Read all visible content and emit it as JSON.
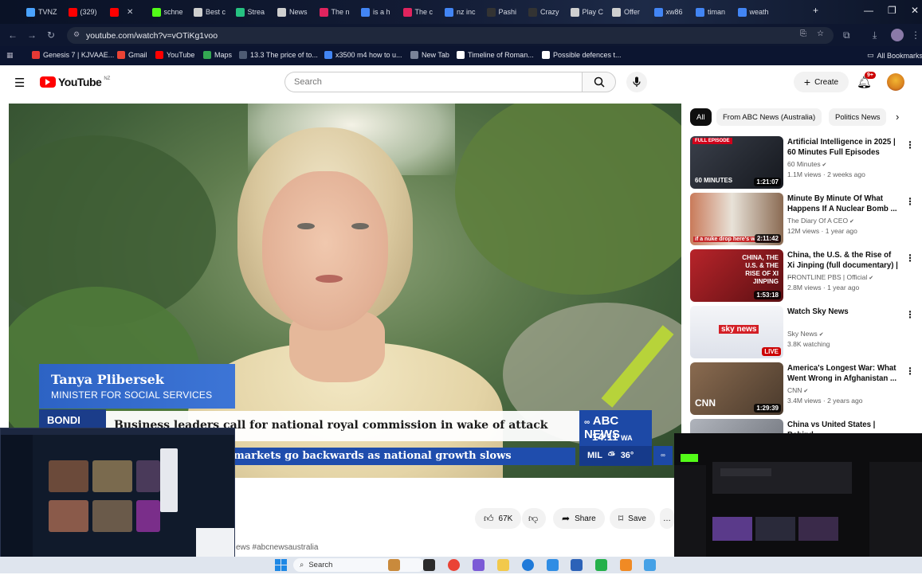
{
  "browser": {
    "tabs": [
      {
        "label": "TVNZ",
        "color": "#4aa3ff"
      },
      {
        "label": "(329)",
        "color": "#ff0000"
      },
      {
        "label": "",
        "color": "#ff0000"
      },
      {
        "label": "schne",
        "color": "#53fc18"
      },
      {
        "label": "Best c",
        "color": "#cfcfcf"
      },
      {
        "label": "Strea",
        "color": "#26c281"
      },
      {
        "label": "News",
        "color": "#cfcfcf"
      },
      {
        "label": "The n",
        "color": "#e0245e"
      },
      {
        "label": "is a h",
        "color": "#4285f4"
      },
      {
        "label": "The c",
        "color": "#e0245e"
      },
      {
        "label": "nz inc",
        "color": "#4285f4"
      },
      {
        "label": "Pashi",
        "color": "#333333"
      },
      {
        "label": "Crazy",
        "color": "#333333"
      },
      {
        "label": "Play C",
        "color": "#cfcfcf"
      },
      {
        "label": "Offer",
        "color": "#cfcfcf"
      },
      {
        "label": "xw86",
        "color": "#4285f4"
      },
      {
        "label": "timan",
        "color": "#4285f4"
      },
      {
        "label": "weath",
        "color": "#4285f4"
      }
    ],
    "new_tab": "+",
    "window_controls": {
      "minimize": "—",
      "restore": "❐",
      "close": "✕"
    },
    "url": "youtube.com/watch?v=vOTiKg1voo",
    "bookmarks": [
      {
        "label": "Genesis 7 | KJVAAE...",
        "color": "#e53935"
      },
      {
        "label": "Gmail",
        "color": "#ea4335"
      },
      {
        "label": "YouTube",
        "color": "#ff0000"
      },
      {
        "label": "Maps",
        "color": "#34a853"
      },
      {
        "label": "13.3 The price of to...",
        "color": "#4e5b73"
      },
      {
        "label": "x3500 m4 how to u...",
        "color": "#4285f4"
      },
      {
        "label": "New Tab",
        "color": "#7a8399"
      },
      {
        "label": "Timeline of Roman...",
        "color": "#ffffff"
      },
      {
        "label": "Possible defences t...",
        "color": "#ffffff"
      }
    ],
    "all_bookmarks": "All Bookmarks"
  },
  "youtube": {
    "logo_text": "YouTube",
    "region": "NZ",
    "search_placeholder": "Search",
    "create_label": "Create",
    "notification_count": "9+",
    "accent": "#ff0000"
  },
  "video": {
    "lower_third_name": "Tanya Plibersek",
    "lower_third_title": "MINISTER FOR SOCIAL SERVICES",
    "location": "BONDI",
    "headline": "Business leaders call for national royal commission in wake of attack",
    "ticker": "markets go backwards as national growth slows",
    "network": "ABC NEWS",
    "time": "14:11",
    "timezone": "WA",
    "weather_city": "MIL",
    "temperature": "36°"
  },
  "actions": {
    "likes": "67K",
    "share": "Share",
    "save": "Save",
    "more": "…"
  },
  "hashtags": "ews #abcnewsaustralia",
  "chips": [
    "All",
    "From ABC News (Australia)",
    "Politics News"
  ],
  "recommendations": [
    {
      "title": "Artificial Intelligence in 2025 | 60 Minutes Full Episodes",
      "channel": "60 Minutes",
      "meta": "1.1M views · 2 weeks ago",
      "duration": "1:21:07",
      "badge": "FULL EPISODE",
      "thumb_text": "60 MINUTES"
    },
    {
      "title": "Minute By Minute Of What Happens If A Nuclear Bomb ...",
      "channel": "The Diary Of A CEO",
      "meta": "12M views · 1 year ago",
      "duration": "2:11:42",
      "badge": "",
      "thumb_text": "if a nuke drop here's what happ"
    },
    {
      "title": "China, the U.S. & the Rise of Xi Jinping (full documentary) | ...",
      "channel": "FRONTLINE PBS | Official",
      "meta": "2.8M views · 1 year ago",
      "duration": "1:53:18",
      "badge": "",
      "thumb_text": "CHINA, THE U.S. & THE RISE OF XI JINPING"
    },
    {
      "title": "Watch Sky News",
      "channel": "Sky News",
      "meta": "3.8K watching",
      "duration": "LIVE",
      "badge": "",
      "thumb_text": "sky news"
    },
    {
      "title": "America's Longest War: What Went Wrong in Afghanistan ...",
      "channel": "CNN",
      "meta": "3.4M views · 2 years ago",
      "duration": "1:29:39",
      "badge": "",
      "thumb_text": "CNN"
    },
    {
      "title": "China vs United States | Behind",
      "channel": "",
      "meta": "",
      "duration": "",
      "badge": "",
      "thumb_text": ""
    }
  ],
  "taskbar": {
    "search": "Search"
  }
}
